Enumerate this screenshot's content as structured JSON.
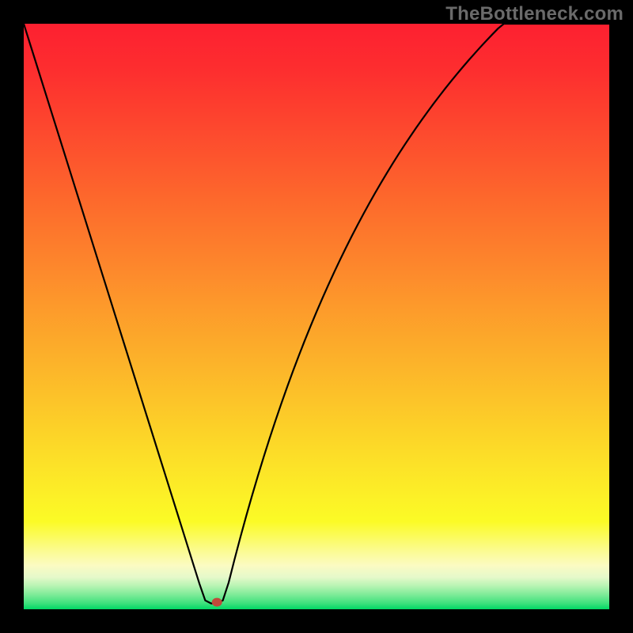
{
  "watermark": "TheBottleneck.com",
  "colors": {
    "page_bg": "#000000",
    "curve": "#000000",
    "marker": "#c04a3a"
  },
  "gradient_stops": [
    {
      "offset": 0.0,
      "color": "#fd2030"
    },
    {
      "offset": 0.08,
      "color": "#fd2e2f"
    },
    {
      "offset": 0.16,
      "color": "#fd432e"
    },
    {
      "offset": 0.24,
      "color": "#fd582d"
    },
    {
      "offset": 0.32,
      "color": "#fd6e2c"
    },
    {
      "offset": 0.4,
      "color": "#fd832c"
    },
    {
      "offset": 0.48,
      "color": "#fd992b"
    },
    {
      "offset": 0.56,
      "color": "#fcae2a"
    },
    {
      "offset": 0.64,
      "color": "#fcc329"
    },
    {
      "offset": 0.72,
      "color": "#fcd928"
    },
    {
      "offset": 0.8,
      "color": "#fcee27"
    },
    {
      "offset": 0.85,
      "color": "#fbfb26"
    },
    {
      "offset": 0.875,
      "color": "#fbfb5a"
    },
    {
      "offset": 0.9,
      "color": "#fbfb91"
    },
    {
      "offset": 0.925,
      "color": "#fbfbc2"
    },
    {
      "offset": 0.945,
      "color": "#e6f9ca"
    },
    {
      "offset": 0.96,
      "color": "#b8f4b3"
    },
    {
      "offset": 0.975,
      "color": "#7eeb98"
    },
    {
      "offset": 0.99,
      "color": "#3de17c"
    },
    {
      "offset": 1.0,
      "color": "#00d864"
    }
  ],
  "chart_data": {
    "type": "line",
    "title": "",
    "xlabel": "",
    "ylabel": "",
    "xlim": [
      0,
      100
    ],
    "ylim": [
      0,
      100
    ],
    "marker": {
      "x": 33,
      "y": 1.2
    },
    "x": [
      0,
      1,
      2,
      3,
      4,
      5,
      6,
      7,
      8,
      9,
      10,
      11,
      12,
      13,
      14,
      15,
      16,
      17,
      18,
      19,
      20,
      21,
      22,
      23,
      24,
      25,
      26,
      27,
      28,
      29,
      30,
      31,
      32,
      33,
      34,
      35,
      36,
      37,
      38,
      39,
      40,
      41,
      42,
      43,
      44,
      45,
      46,
      47,
      48,
      49,
      50,
      51,
      52,
      53,
      54,
      55,
      56,
      57,
      58,
      59,
      60,
      61,
      62,
      63,
      64,
      65,
      66,
      67,
      68,
      69,
      70,
      71,
      72,
      73,
      74,
      75,
      76,
      77,
      78,
      79,
      80,
      81,
      82,
      83,
      84,
      85,
      86,
      87,
      88,
      89,
      90,
      91,
      92,
      93,
      94,
      95,
      96,
      97,
      98,
      99,
      100
    ],
    "y": [
      100.0,
      96.81,
      93.63,
      90.44,
      87.25,
      84.06,
      80.88,
      77.69,
      74.5,
      71.31,
      68.13,
      64.94,
      61.75,
      58.56,
      55.38,
      52.19,
      49.0,
      45.81,
      42.63,
      39.44,
      36.25,
      33.06,
      29.88,
      26.69,
      23.5,
      20.31,
      17.13,
      13.94,
      10.75,
      7.56,
      4.38,
      1.5,
      1.0,
      1.0,
      1.5,
      4.57,
      8.51,
      12.3,
      15.94,
      19.44,
      22.82,
      26.07,
      29.21,
      32.24,
      35.16,
      37.99,
      40.72,
      43.36,
      45.92,
      48.39,
      50.78,
      53.1,
      55.35,
      57.53,
      59.64,
      61.69,
      63.68,
      65.61,
      67.48,
      69.31,
      71.08,
      72.8,
      74.47,
      76.1,
      77.69,
      79.23,
      80.73,
      82.19,
      83.62,
      85.0,
      86.36,
      87.67,
      88.96,
      90.21,
      91.43,
      92.62,
      93.78,
      94.91,
      96.02,
      97.1,
      98.15,
      99.18,
      100.0,
      100.0,
      100.0,
      100.0,
      100.0,
      100.0,
      100.0,
      100.0,
      100.0,
      100.0,
      100.0,
      100.0,
      100.0,
      100.0,
      100.0,
      100.0,
      100.0,
      100.0,
      100.0
    ]
  }
}
